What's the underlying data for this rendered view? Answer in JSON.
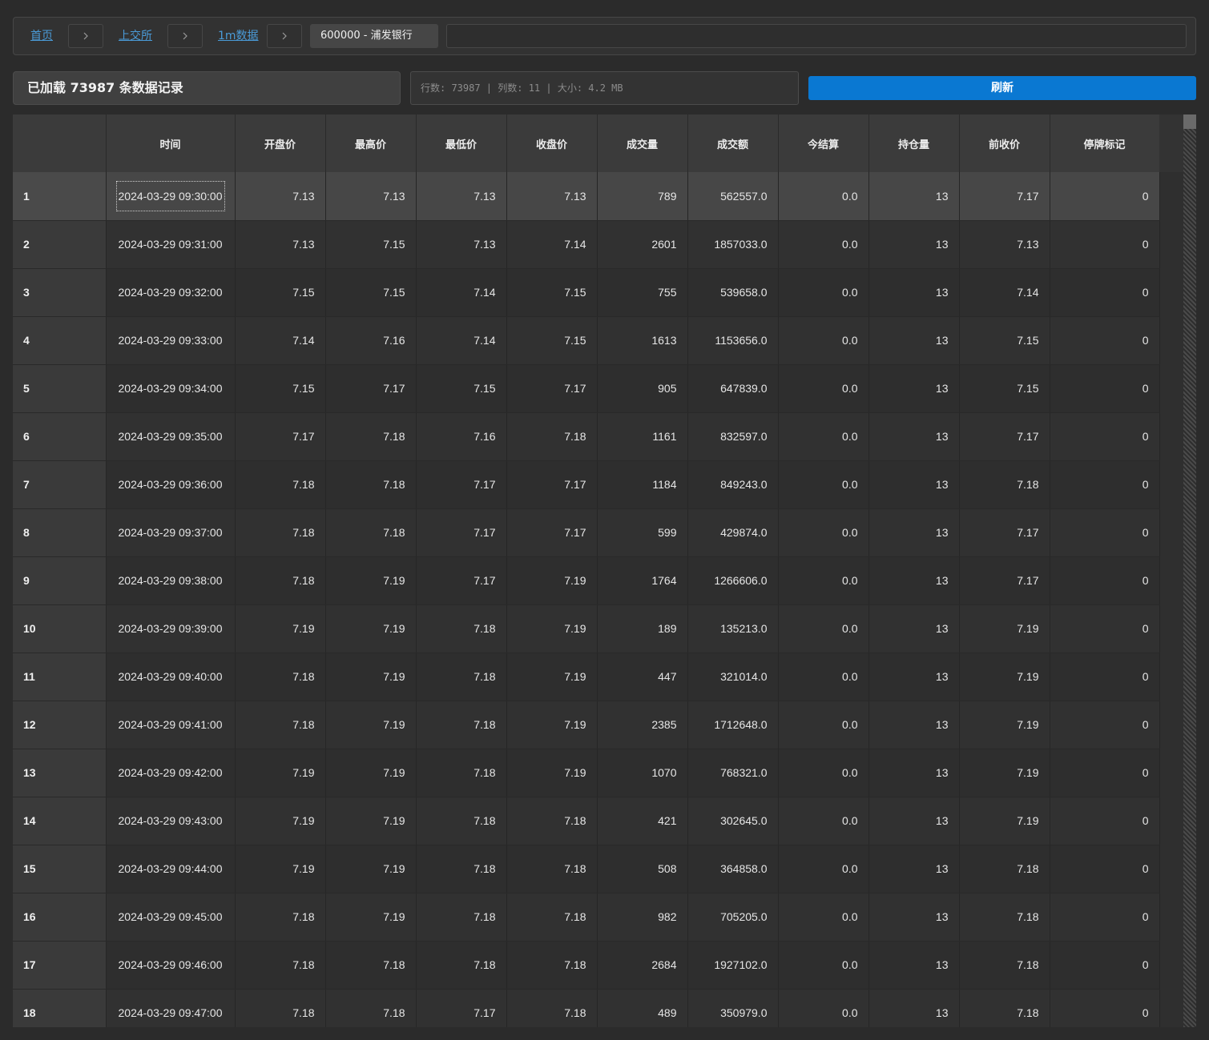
{
  "breadcrumb": {
    "items": [
      "首页",
      "上交所",
      "1m数据"
    ],
    "current": "600000 - 浦发银行"
  },
  "status": {
    "loaded": "已加载 73987 条数据记录",
    "info": "行数: 73987 | 列数: 11 | 大小: 4.2 MB",
    "refresh_label": "刷新"
  },
  "table": {
    "columns": [
      "时间",
      "开盘价",
      "最高价",
      "最低价",
      "收盘价",
      "成交量",
      "成交额",
      "今结算",
      "持仓量",
      "前收价",
      "停牌标记"
    ],
    "rows": [
      [
        "1",
        "2024-03-29 09:30:00",
        "7.13",
        "7.13",
        "7.13",
        "7.13",
        "789",
        "562557.0",
        "0.0",
        "13",
        "7.17",
        "0"
      ],
      [
        "2",
        "2024-03-29 09:31:00",
        "7.13",
        "7.15",
        "7.13",
        "7.14",
        "2601",
        "1857033.0",
        "0.0",
        "13",
        "7.13",
        "0"
      ],
      [
        "3",
        "2024-03-29 09:32:00",
        "7.15",
        "7.15",
        "7.14",
        "7.15",
        "755",
        "539658.0",
        "0.0",
        "13",
        "7.14",
        "0"
      ],
      [
        "4",
        "2024-03-29 09:33:00",
        "7.14",
        "7.16",
        "7.14",
        "7.15",
        "1613",
        "1153656.0",
        "0.0",
        "13",
        "7.15",
        "0"
      ],
      [
        "5",
        "2024-03-29 09:34:00",
        "7.15",
        "7.17",
        "7.15",
        "7.17",
        "905",
        "647839.0",
        "0.0",
        "13",
        "7.15",
        "0"
      ],
      [
        "6",
        "2024-03-29 09:35:00",
        "7.17",
        "7.18",
        "7.16",
        "7.18",
        "1161",
        "832597.0",
        "0.0",
        "13",
        "7.17",
        "0"
      ],
      [
        "7",
        "2024-03-29 09:36:00",
        "7.18",
        "7.18",
        "7.17",
        "7.17",
        "1184",
        "849243.0",
        "0.0",
        "13",
        "7.18",
        "0"
      ],
      [
        "8",
        "2024-03-29 09:37:00",
        "7.18",
        "7.18",
        "7.17",
        "7.17",
        "599",
        "429874.0",
        "0.0",
        "13",
        "7.17",
        "0"
      ],
      [
        "9",
        "2024-03-29 09:38:00",
        "7.18",
        "7.19",
        "7.17",
        "7.19",
        "1764",
        "1266606.0",
        "0.0",
        "13",
        "7.17",
        "0"
      ],
      [
        "10",
        "2024-03-29 09:39:00",
        "7.19",
        "7.19",
        "7.18",
        "7.19",
        "189",
        "135213.0",
        "0.0",
        "13",
        "7.19",
        "0"
      ],
      [
        "11",
        "2024-03-29 09:40:00",
        "7.18",
        "7.19",
        "7.18",
        "7.19",
        "447",
        "321014.0",
        "0.0",
        "13",
        "7.19",
        "0"
      ],
      [
        "12",
        "2024-03-29 09:41:00",
        "7.18",
        "7.19",
        "7.18",
        "7.19",
        "2385",
        "1712648.0",
        "0.0",
        "13",
        "7.19",
        "0"
      ],
      [
        "13",
        "2024-03-29 09:42:00",
        "7.19",
        "7.19",
        "7.18",
        "7.19",
        "1070",
        "768321.0",
        "0.0",
        "13",
        "7.19",
        "0"
      ],
      [
        "14",
        "2024-03-29 09:43:00",
        "7.19",
        "7.19",
        "7.18",
        "7.18",
        "421",
        "302645.0",
        "0.0",
        "13",
        "7.19",
        "0"
      ],
      [
        "15",
        "2024-03-29 09:44:00",
        "7.19",
        "7.19",
        "7.18",
        "7.18",
        "508",
        "364858.0",
        "0.0",
        "13",
        "7.18",
        "0"
      ],
      [
        "16",
        "2024-03-29 09:45:00",
        "7.18",
        "7.19",
        "7.18",
        "7.18",
        "982",
        "705205.0",
        "0.0",
        "13",
        "7.18",
        "0"
      ],
      [
        "17",
        "2024-03-29 09:46:00",
        "7.18",
        "7.18",
        "7.18",
        "7.18",
        "2684",
        "1927102.0",
        "0.0",
        "13",
        "7.18",
        "0"
      ],
      [
        "18",
        "2024-03-29 09:47:00",
        "7.18",
        "7.18",
        "7.17",
        "7.18",
        "489",
        "350979.0",
        "0.0",
        "13",
        "7.18",
        "0"
      ]
    ],
    "selected_row": 0
  },
  "icons": {
    "separator": "chevron-right-icon"
  }
}
